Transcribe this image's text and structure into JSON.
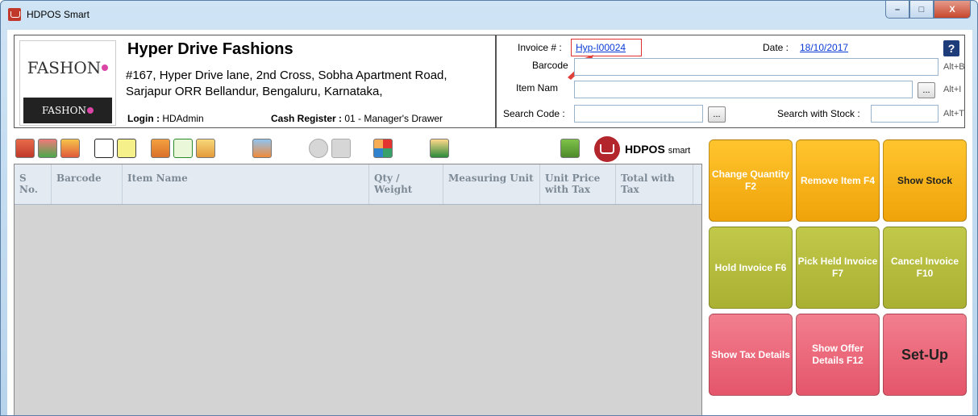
{
  "window": {
    "title": "HDPOS Smart",
    "min": "–",
    "max": "□",
    "close": "X"
  },
  "store": {
    "name": "Hyper Drive Fashions",
    "address": "#167, Hyper Drive lane, 2nd Cross, Sobha Apartment Road, Sarjapur ORR Bellandur, Bengaluru, Karnataka,",
    "login_label": "Login :",
    "login_value": "HDAdmin",
    "cash_label": "Cash Register :",
    "cash_value": "01 - Manager's Drawer",
    "logo_text": "FASHON",
    "logo_small": "FASHON"
  },
  "invoice": {
    "invoice_label": "Invoice # :",
    "invoice_value": "Hyp-I00024",
    "date_label": "Date :",
    "date_value": "18/10/2017",
    "barcode_label": "Barcode",
    "barcode_hotkey": "Alt+B",
    "item_name_label": "Item Nam",
    "item_name_hotkey": "Alt+I",
    "search_code_label": "Search Code :",
    "search_stock_label": "Search with Stock :",
    "search_stock_hotkey": "Alt+T",
    "help": "?",
    "ellipsis": "..."
  },
  "brand": {
    "name": "HDPOS",
    "suffix": "smart"
  },
  "grid": {
    "columns": [
      "S No.",
      "Barcode",
      "Item Name",
      "Qty / Weight",
      "Measuring Unit",
      "Unit Price with Tax",
      "Total with Tax"
    ]
  },
  "actions": {
    "change_quantity": "Change Quantity F2",
    "remove_item": "Remove Item F4",
    "show_stock": "Show Stock",
    "hold_invoice": "Hold Invoice F6",
    "pick_held_invoice": "Pick Held Invoice F7",
    "cancel_invoice": "Cancel Invoice F10",
    "show_tax_details": "Show Tax Details",
    "show_offer_details": "Show Offer Details F12",
    "setup": "Set-Up"
  },
  "colors": {
    "orange": "#f6b41c",
    "olive": "#b6bd3c",
    "pink": "#ea6a7b",
    "highlight": "#e03030"
  }
}
